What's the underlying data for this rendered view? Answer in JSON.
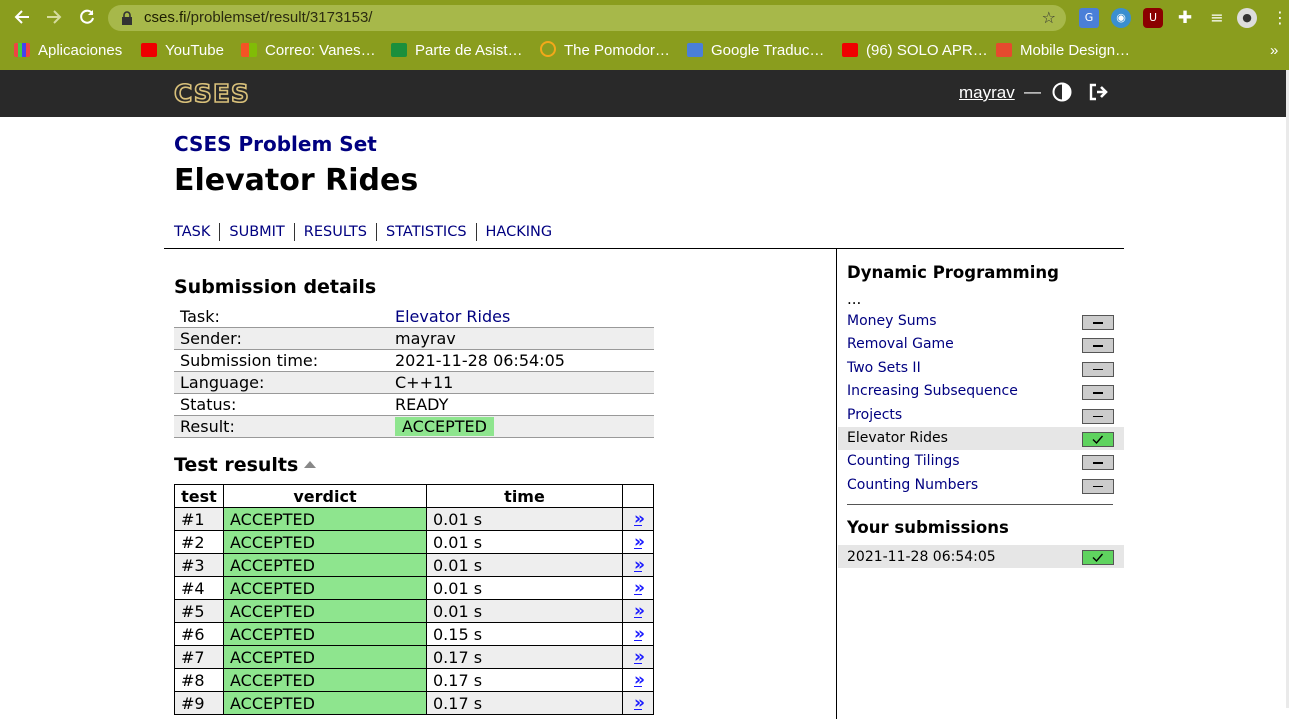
{
  "browser": {
    "url_host": "cses.fi",
    "url_path": "/problemset/result/3173153/",
    "bookmarks": [
      {
        "label": "Aplicaciones",
        "icon": "apps-grid-icon"
      },
      {
        "label": "YouTube",
        "icon": "youtube-icon"
      },
      {
        "label": "Correo: Vanes…",
        "icon": "outlook-icon"
      },
      {
        "label": "Parte de Asist…",
        "icon": "bookmark-green-icon"
      },
      {
        "label": "The Pomodor…",
        "icon": "pomodoro-icon"
      },
      {
        "label": "Google Traduc…",
        "icon": "google-translate-icon"
      },
      {
        "label": "(96) SOLO APR…",
        "icon": "youtube-icon"
      },
      {
        "label": "Mobile Design…",
        "icon": "pinterest-icon"
      }
    ],
    "more_bookmarks": "»"
  },
  "header": {
    "logo": "CSES",
    "username": "mayrav",
    "separator": "—"
  },
  "page": {
    "suptitle": "CSES Problem Set",
    "title": "Elevator Rides",
    "tabs": [
      "TASK",
      "SUBMIT",
      "RESULTS",
      "STATISTICS",
      "HACKING"
    ]
  },
  "details": {
    "heading": "Submission details",
    "rows": [
      {
        "label": "Task:",
        "value": "Elevator Rides"
      },
      {
        "label": "Sender:",
        "value": "mayrav"
      },
      {
        "label": "Submission time:",
        "value": "2021-11-28 06:54:05"
      },
      {
        "label": "Language:",
        "value": "C++11"
      },
      {
        "label": "Status:",
        "value": "READY"
      },
      {
        "label": "Result:",
        "value": "ACCEPTED"
      }
    ]
  },
  "tests": {
    "heading": "Test results",
    "columns": [
      "test",
      "verdict",
      "time"
    ],
    "rows": [
      {
        "test": "#1",
        "verdict": "ACCEPTED",
        "time": "0.01 s"
      },
      {
        "test": "#2",
        "verdict": "ACCEPTED",
        "time": "0.01 s"
      },
      {
        "test": "#3",
        "verdict": "ACCEPTED",
        "time": "0.01 s"
      },
      {
        "test": "#4",
        "verdict": "ACCEPTED",
        "time": "0.01 s"
      },
      {
        "test": "#5",
        "verdict": "ACCEPTED",
        "time": "0.01 s"
      },
      {
        "test": "#6",
        "verdict": "ACCEPTED",
        "time": "0.15 s"
      },
      {
        "test": "#7",
        "verdict": "ACCEPTED",
        "time": "0.17 s"
      },
      {
        "test": "#8",
        "verdict": "ACCEPTED",
        "time": "0.17 s"
      },
      {
        "test": "#9",
        "verdict": "ACCEPTED",
        "time": "0.17 s"
      }
    ],
    "link_label": "»"
  },
  "sidebar": {
    "heading": "Dynamic Programming",
    "ellipsis": "...",
    "tasks": [
      {
        "name": "Money Sums",
        "status": "none"
      },
      {
        "name": "Removal Game",
        "status": "none"
      },
      {
        "name": "Two Sets II",
        "status": "none"
      },
      {
        "name": "Increasing Subsequence",
        "status": "none"
      },
      {
        "name": "Projects",
        "status": "none"
      },
      {
        "name": "Elevator Rides",
        "status": "ok",
        "current": true
      },
      {
        "name": "Counting Tilings",
        "status": "none"
      },
      {
        "name": "Counting Numbers",
        "status": "none"
      }
    ],
    "submissions_heading": "Your submissions",
    "submissions": [
      {
        "time": "2021-11-28 06:54:05",
        "status": "ok"
      }
    ]
  },
  "colors": {
    "chrome": "#8a9d1e",
    "header": "#292929",
    "link": "#000080",
    "accepted": "#8ee58e"
  }
}
